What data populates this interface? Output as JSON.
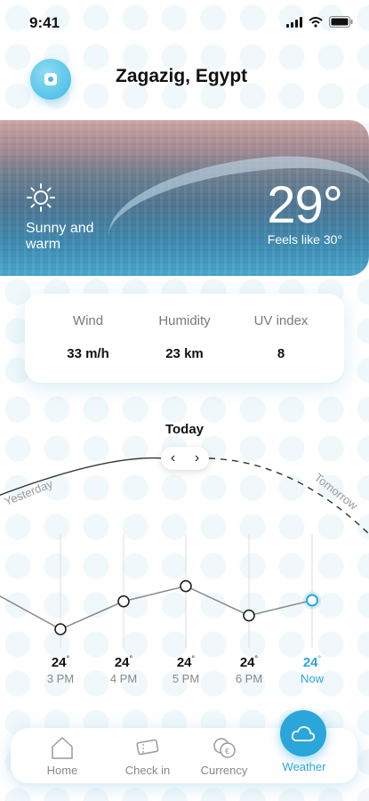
{
  "status_bar": {
    "time": "9:41",
    "icons": [
      "signal-icon",
      "wifi-icon",
      "battery-icon"
    ]
  },
  "header": {
    "location": "Zagazig, Egypt"
  },
  "hero": {
    "condition": "Sunny and warm",
    "temperature": "29°",
    "feels_like": "Feels like 30°",
    "icon": "sun-icon"
  },
  "stats": [
    {
      "label": "Wind",
      "value": "33 m/h"
    },
    {
      "label": "Humidity",
      "value": "23 km"
    },
    {
      "label": "UV index",
      "value": "8"
    }
  ],
  "timeline": {
    "today_label": "Today",
    "yesterday_label": "Yesterday",
    "tomorrow_label": "Tomorrow",
    "hours": [
      {
        "temp": "24",
        "time": "3 PM",
        "level": 0.0
      },
      {
        "temp": "24",
        "time": "4 PM",
        "level": 0.55
      },
      {
        "temp": "24",
        "time": "5 PM",
        "level": 0.85
      },
      {
        "temp": "24",
        "time": "6 PM",
        "level": 0.27
      },
      {
        "temp": "24",
        "time": "Now",
        "level": 0.57,
        "active": true
      }
    ]
  },
  "nav": {
    "items": [
      {
        "label": "Home",
        "icon": "home-icon"
      },
      {
        "label": "Check in",
        "icon": "ticket-icon"
      },
      {
        "label": "Currency",
        "icon": "currency-icon"
      },
      {
        "label": "Weather",
        "icon": "cloud-icon",
        "active": true
      }
    ]
  },
  "colors": {
    "accent": "#2aa6da",
    "text": "#111111",
    "muted": "#888888"
  }
}
